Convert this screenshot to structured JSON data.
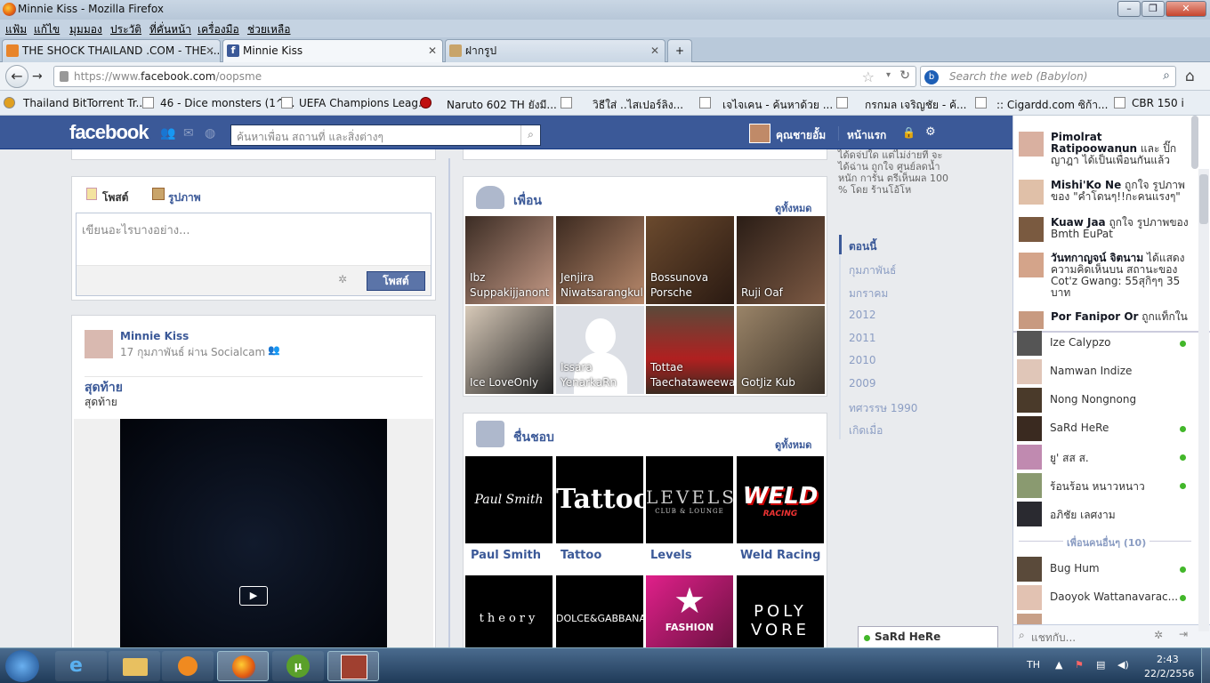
{
  "window": {
    "title": "Minnie Kiss - Mozilla Firefox"
  },
  "menu": [
    "แฟ้ม",
    "แก้ไข",
    "มุมมอง",
    "ประวัติ",
    "ที่คั่นหน้า",
    "เครื่องมือ",
    "ช่วยเหลือ"
  ],
  "tabs": [
    {
      "label": "THE SHOCK THAILAND .COM - THE ..."
    },
    {
      "label": "Minnie Kiss"
    },
    {
      "label": "ฝากรูป"
    }
  ],
  "url": {
    "prefix": "https://www.",
    "domain": "facebook.com",
    "path": "/oopsme"
  },
  "search": {
    "placeholder": "Search the web (Babylon)"
  },
  "bookmarks": [
    "Thailand BitTorrent Tr...",
    "46 - Dice monsters (1^...",
    "UEFA Champions Leag...",
    "Naruto 602 TH ยังมี...",
    "วิธีใส่ ..ไสเปอร์ลิง...",
    "เจไจเคน - ค้นหาด้วย ...",
    "กรกมล เจริญชัย - ค้...",
    ":: Cigardd.com ซิก้า...",
    "CBR 150 i"
  ],
  "fb": {
    "logo": "facebook",
    "search_placeholder": "ค้นหาเพื่อน สถานที่ และสิ่งต่างๆ",
    "user": "คุณชายอั้ม",
    "home": "หน้าแรก",
    "composer": {
      "tab_post": "โพสต์",
      "tab_photo": "รูปภาพ",
      "placeholder": "เขียนอะไรบางอย่าง...",
      "submit": "โพสต์"
    },
    "post": {
      "author": "Minnie Kiss",
      "meta": "17 กุมภาพันธ์ ผ่าน Socialcam",
      "title": "สุดท้าย",
      "subtitle": "สุดท้าย"
    },
    "friends": {
      "title": "เพื่อน",
      "see_all": "ดูทั้งหมด",
      "items": [
        "Ibz Suppakijjanont",
        "Jenjira Niwatsarangkul",
        "Bossunova Porsche",
        "Ruji Oaf",
        "Ice LoveOnly",
        "Issara YenarkaRn",
        "Tottae Taechataweewan",
        "GotJiz Kub"
      ]
    },
    "likes": {
      "title": "ชื่นชอบ",
      "see_all": "ดูทั้งหมด",
      "items": [
        "Paul Smith",
        "Tattoo",
        "Levels",
        "Weld Racing"
      ],
      "row2": [
        "theory",
        "DOLCE&GABBANA",
        "FASHION",
        "POLY VORE"
      ]
    },
    "logos": {
      "paul": "Paul Smith",
      "tattoo": "Tattoo",
      "levels": "LEVELS",
      "levels_sub": "CLUB & LOUNGE",
      "weld": "WELD",
      "weld_sub": "RACING"
    },
    "side_text": "ได้ดจ่ปใด แต่ไม่ง่ายที่ จะได้ฉ่าน ถูกใจ ศูนย์ลดน้ำหนัก การัน ตรีเห็นผล 100 % โดย ร้านโอ้โห",
    "timeline": [
      "ตอนนี้",
      "กุมภาพันธ์",
      "มกราคม",
      "2012",
      "2011",
      "2010",
      "2009",
      "ทศวรรษ 1990",
      "เกิดเมื่อ"
    ]
  },
  "ticker": [
    {
      "name": "Pimolrat Ratipoowanun",
      "text": "และ ปิ๊ก ญาฎา ได้เป็นเพื่อนกันแล้ว"
    },
    {
      "name": "Mishi'Ko Ne",
      "text": "ถูกใจ รูปภาพของ \"คำโดนๆ!!กะคนแรงๆ\""
    },
    {
      "name": "Kuaw Jaa",
      "text": "ถูกใจ รูปภาพของ Bmth EuPat"
    },
    {
      "name": "วันทกาญจน์ จิตนาม",
      "text": "ได้แสดงความคิดเห็นบน สถานะของ Cot'z Gwang: 55สุกิๆๆ 35 บาท"
    },
    {
      "name": "Por Fanipor Or",
      "text": "ถูกแท็กใน"
    }
  ],
  "chat": {
    "online": [
      "Ize Calypzo",
      "Namwan Indize",
      "Nong Nongnong",
      "SaRd HeRe",
      "ยู' สส ส.",
      "ร้อนร้อน หนาวหนาว",
      "อภิชัย เลศงาม"
    ],
    "more_label": "เพื่อนคนอื่นๆ (10)",
    "more": [
      "Bug Hum",
      "Daoyok Wattanavarac..."
    ],
    "search_placeholder": "แชทกับ...",
    "open_tab": "SaRd HeRe"
  },
  "tray": {
    "lang": "TH",
    "time": "2:43",
    "date": "22/2/2556"
  }
}
